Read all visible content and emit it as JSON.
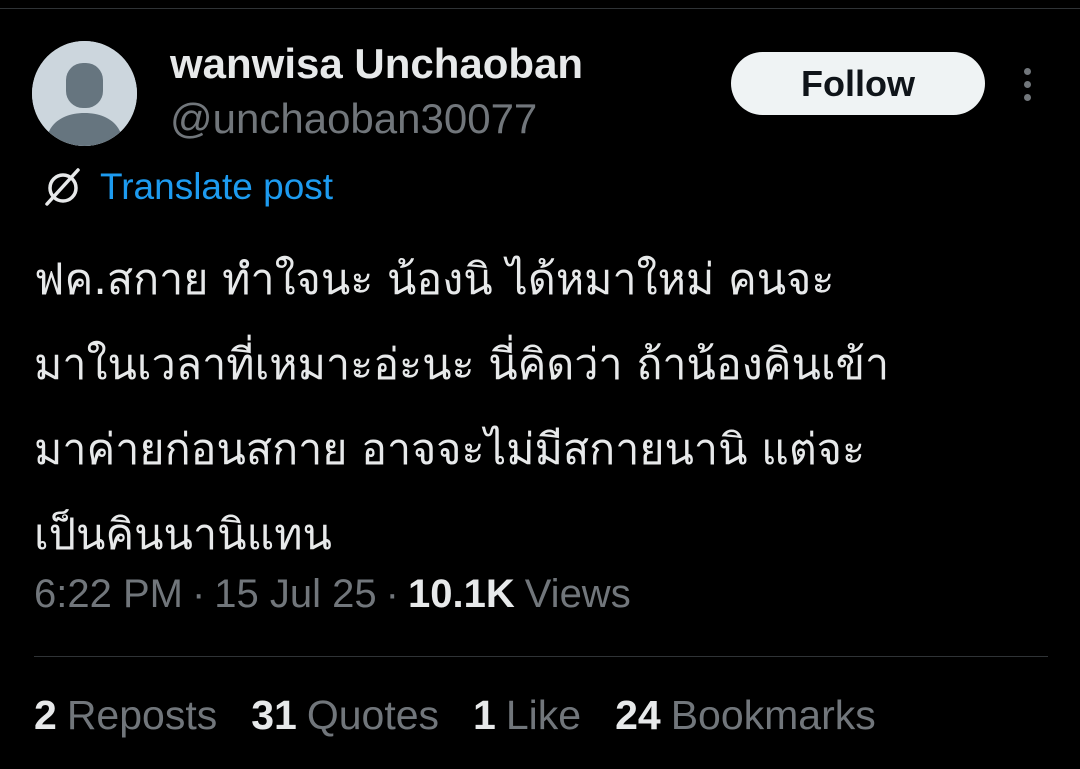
{
  "author": {
    "display_name": "wanwisa Unchaoban",
    "handle": "@unchaoban30077",
    "avatar_icon": "default-avatar-icon"
  },
  "follow_label": "Follow",
  "more_icon": "more-vertical-icon",
  "translate": {
    "icon": "globe-slash-icon",
    "label": "Translate post"
  },
  "post_lines": [
    "ฟค.สกาย ทำใจนะ น้องนิ ได้หมาใหม่ คนจะ",
    "มาในเวลาที่เหมาะอ่ะนะ นี่คิดว่า ถ้าน้องคินเข้า",
    "มาค่ายก่อนสกาย อาจจะไม่มีสกายนานิ แต่จะ",
    "เป็นคินนานิแทน"
  ],
  "meta": {
    "time": "6:22 PM",
    "date": "15 Jul 25",
    "views_count": "10.1K",
    "views_label": "Views",
    "separator": "·"
  },
  "stats": [
    {
      "count": "2",
      "label": "Reposts"
    },
    {
      "count": "31",
      "label": "Quotes"
    },
    {
      "count": "1",
      "label": "Like"
    },
    {
      "count": "24",
      "label": "Bookmarks"
    }
  ],
  "colors": {
    "background": "#000000",
    "text": "#e7e9ea",
    "secondary": "#71767b",
    "accent": "#1d9bf0",
    "divider": "#2f3336"
  }
}
